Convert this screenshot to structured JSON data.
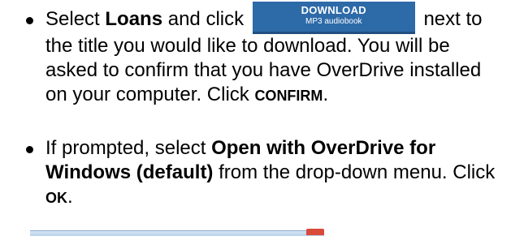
{
  "instructions": {
    "item1": {
      "pre": "Select ",
      "loans": "Loans",
      "mid": " and click ",
      "button": {
        "line1": "DOWNLOAD",
        "line2": "MP3 audiobook"
      },
      "post": " next to the title you would like to download. You will be asked to confirm that you have OverDrive installed on your computer. Click ",
      "confirm": "CONFIRM",
      "end": "."
    },
    "item2": {
      "pre": "If prompted, select ",
      "option": "Open with OverDrive for Windows (default)",
      "mid": " from the drop-down menu. Click ",
      "ok": "OK",
      "end": "."
    }
  }
}
